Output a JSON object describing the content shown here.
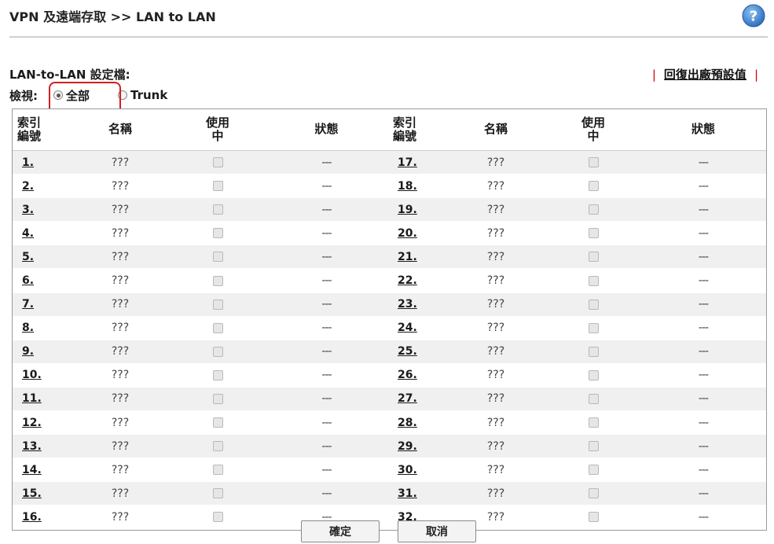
{
  "header": {
    "title": "VPN 及遠端存取 >> LAN to LAN",
    "help_icon": "question-icon",
    "help_color": "#3a86d6"
  },
  "section": {
    "title": "LAN-to-LAN 設定檔:",
    "restore_label": "回復出廠預設值"
  },
  "view": {
    "label": "檢視:",
    "options": [
      {
        "label": "全部",
        "checked": true
      },
      {
        "label": "Trunk",
        "checked": false
      }
    ]
  },
  "table": {
    "headers": {
      "index": "索引\n編號",
      "name": "名稱",
      "enable": "使用\n中",
      "status": "狀態"
    },
    "rows": [
      {
        "l": {
          "idx": "1.",
          "name": "???",
          "status": "---"
        },
        "r": {
          "idx": "17.",
          "name": "???",
          "status": "---"
        }
      },
      {
        "l": {
          "idx": "2.",
          "name": "???",
          "status": "---"
        },
        "r": {
          "idx": "18.",
          "name": "???",
          "status": "---"
        }
      },
      {
        "l": {
          "idx": "3.",
          "name": "???",
          "status": "---"
        },
        "r": {
          "idx": "19.",
          "name": "???",
          "status": "---"
        }
      },
      {
        "l": {
          "idx": "4.",
          "name": "???",
          "status": "---"
        },
        "r": {
          "idx": "20.",
          "name": "???",
          "status": "---"
        }
      },
      {
        "l": {
          "idx": "5.",
          "name": "???",
          "status": "---"
        },
        "r": {
          "idx": "21.",
          "name": "???",
          "status": "---"
        }
      },
      {
        "l": {
          "idx": "6.",
          "name": "???",
          "status": "---"
        },
        "r": {
          "idx": "22.",
          "name": "???",
          "status": "---"
        }
      },
      {
        "l": {
          "idx": "7.",
          "name": "???",
          "status": "---"
        },
        "r": {
          "idx": "23.",
          "name": "???",
          "status": "---"
        }
      },
      {
        "l": {
          "idx": "8.",
          "name": "???",
          "status": "---"
        },
        "r": {
          "idx": "24.",
          "name": "???",
          "status": "---"
        }
      },
      {
        "l": {
          "idx": "9.",
          "name": "???",
          "status": "---"
        },
        "r": {
          "idx": "25.",
          "name": "???",
          "status": "---"
        }
      },
      {
        "l": {
          "idx": "10.",
          "name": "???",
          "status": "---"
        },
        "r": {
          "idx": "26.",
          "name": "???",
          "status": "---"
        }
      },
      {
        "l": {
          "idx": "11.",
          "name": "???",
          "status": "---"
        },
        "r": {
          "idx": "27.",
          "name": "???",
          "status": "---"
        }
      },
      {
        "l": {
          "idx": "12.",
          "name": "???",
          "status": "---"
        },
        "r": {
          "idx": "28.",
          "name": "???",
          "status": "---"
        }
      },
      {
        "l": {
          "idx": "13.",
          "name": "???",
          "status": "---"
        },
        "r": {
          "idx": "29.",
          "name": "???",
          "status": "---"
        }
      },
      {
        "l": {
          "idx": "14.",
          "name": "???",
          "status": "---"
        },
        "r": {
          "idx": "30.",
          "name": "???",
          "status": "---"
        }
      },
      {
        "l": {
          "idx": "15.",
          "name": "???",
          "status": "---"
        },
        "r": {
          "idx": "31.",
          "name": "???",
          "status": "---"
        }
      },
      {
        "l": {
          "idx": "16.",
          "name": "???",
          "status": "---"
        },
        "r": {
          "idx": "32.",
          "name": "???",
          "status": "---"
        }
      }
    ]
  },
  "buttons": {
    "ok": "確定",
    "cancel": "取消"
  },
  "colors": {
    "highlight": "#d21f1f",
    "row_alt": "#f0f0f0",
    "restore_separator": "#cc0000"
  }
}
